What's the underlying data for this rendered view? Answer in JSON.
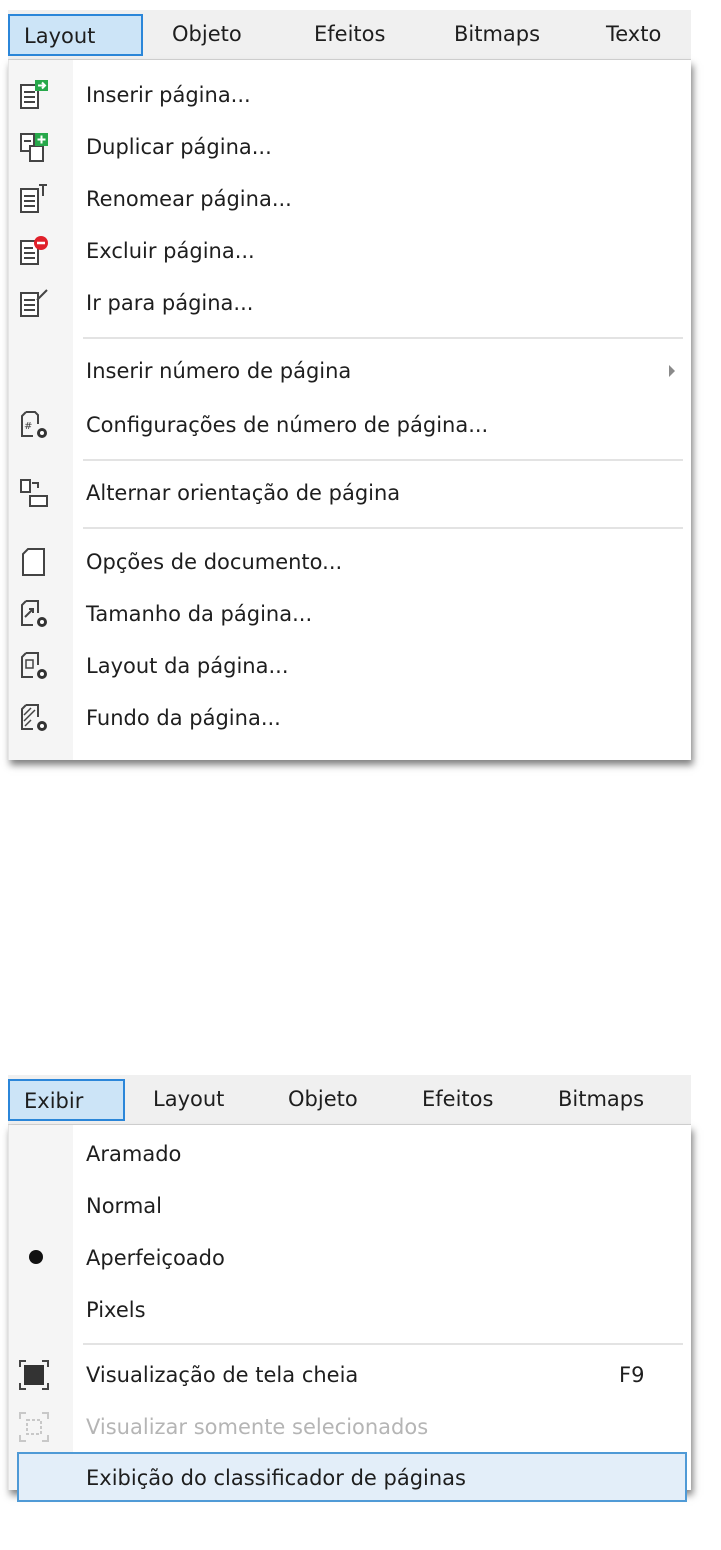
{
  "top_menu": {
    "menubar": [
      "Layout",
      "Objeto",
      "Efeitos",
      "Bitmaps",
      "Texto"
    ],
    "items": {
      "insert_page": "Inserir página...",
      "duplicate_page": "Duplicar página...",
      "rename_page": "Renomear página...",
      "delete_page": "Excluir página...",
      "go_to_page": "Ir para página...",
      "insert_page_number": "Inserir número de página",
      "page_number_settings": "Configurações de número de página...",
      "switch_orientation": "Alternar orientação de página",
      "document_options": "Opções de documento...",
      "page_size": "Tamanho da página...",
      "page_layout": "Layout da página...",
      "page_background": "Fundo da página..."
    }
  },
  "bottom_menu": {
    "menubar": [
      "Exibir",
      "Layout",
      "Objeto",
      "Efeitos",
      "Bitmaps"
    ],
    "items": {
      "wireframe": "Aramado",
      "normal": "Normal",
      "enhanced": "Aperfeiçoado",
      "pixels": "Pixels",
      "full_screen": "Visualização de tela cheia",
      "full_screen_shortcut": "F9",
      "view_selected_only": "Visualizar somente selecionados",
      "page_sorter_view": "Exibição do classificador de páginas"
    }
  },
  "colors": {
    "active_menu_bg": "#cce4f7",
    "active_menu_border": "#2b86d9",
    "selected_item_bg": "#e3eef9",
    "selected_item_border": "#4f9ad6",
    "icon_green": "#27a84a",
    "icon_red": "#e0202a",
    "disabled_text": "#b5b5b5"
  }
}
